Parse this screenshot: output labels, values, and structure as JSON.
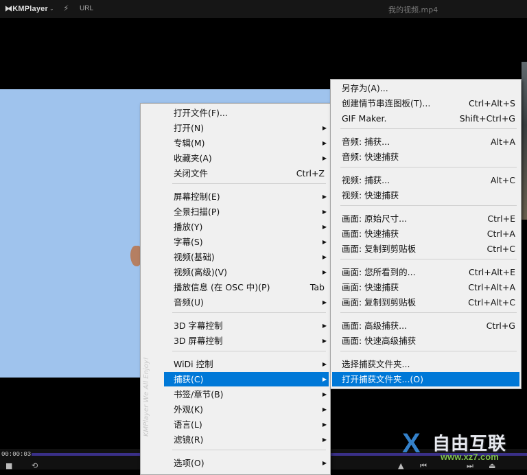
{
  "titlebar": {
    "app_name": "KMPlayer",
    "chevron": "⌄",
    "url_label": "URL",
    "file_name": "我的视频.mp4"
  },
  "player": {
    "time": "00:00:03"
  },
  "sidebar_text": "KMPlayer We All Enjoy!",
  "main_menu": [
    {
      "label": "打开文件(F)...",
      "shortcut": "",
      "submenu": false
    },
    {
      "label": "打开(N)",
      "shortcut": "",
      "submenu": true
    },
    {
      "label": "专辑(M)",
      "shortcut": "",
      "submenu": true
    },
    {
      "label": "收藏夹(A)",
      "shortcut": "",
      "submenu": true
    },
    {
      "label": "关闭文件",
      "shortcut": "Ctrl+Z",
      "submenu": false
    },
    {
      "label": "屏幕控制(E)",
      "shortcut": "",
      "submenu": true
    },
    {
      "label": "全景扫描(P)",
      "shortcut": "",
      "submenu": true
    },
    {
      "label": "播放(Y)",
      "shortcut": "",
      "submenu": true
    },
    {
      "label": "字幕(S)",
      "shortcut": "",
      "submenu": true
    },
    {
      "label": "视频(基础)",
      "shortcut": "",
      "submenu": true
    },
    {
      "label": "视频(高级)(V)",
      "shortcut": "",
      "submenu": true
    },
    {
      "label": "播放信息 (在 OSC 中)(P)",
      "shortcut": "Tab",
      "submenu": false
    },
    {
      "label": "音频(U)",
      "shortcut": "",
      "submenu": true
    },
    {
      "label": "3D 字幕控制",
      "shortcut": "",
      "submenu": true
    },
    {
      "label": "3D 屏幕控制",
      "shortcut": "",
      "submenu": true
    },
    {
      "label": "WiDi 控制",
      "shortcut": "",
      "submenu": true
    },
    {
      "label": "捕获(C)",
      "shortcut": "",
      "submenu": true,
      "highlighted": true
    },
    {
      "label": "书签/章节(B)",
      "shortcut": "",
      "submenu": true
    },
    {
      "label": "外观(K)",
      "shortcut": "",
      "submenu": true
    },
    {
      "label": "语言(L)",
      "shortcut": "",
      "submenu": true
    },
    {
      "label": "滤镜(R)",
      "shortcut": "",
      "submenu": true
    },
    {
      "label": "选项(O)",
      "shortcut": "",
      "submenu": true
    }
  ],
  "capture_menu": [
    {
      "label": "另存为(A)...",
      "shortcut": ""
    },
    {
      "label": "创建情节串连图板(T)...",
      "shortcut": "Ctrl+Alt+S"
    },
    {
      "label": "GIF Maker.",
      "shortcut": "Shift+Ctrl+G"
    },
    {
      "label": "音频: 捕获...",
      "shortcut": "Alt+A"
    },
    {
      "label": "音频: 快速捕获",
      "shortcut": ""
    },
    {
      "label": "视频: 捕获...",
      "shortcut": "Alt+C"
    },
    {
      "label": "视频: 快速捕获",
      "shortcut": ""
    },
    {
      "label": "画面: 原始尺寸...",
      "shortcut": "Ctrl+E"
    },
    {
      "label": "画面: 快速捕获",
      "shortcut": "Ctrl+A"
    },
    {
      "label": "画面: 复制到剪贴板",
      "shortcut": "Ctrl+C"
    },
    {
      "label": "画面: 您所看到的...",
      "shortcut": "Ctrl+Alt+E"
    },
    {
      "label": "画面: 快速捕获",
      "shortcut": "Ctrl+Alt+A"
    },
    {
      "label": "画面: 复制到剪贴板",
      "shortcut": "Ctrl+Alt+C"
    },
    {
      "label": "画面: 高级捕获...",
      "shortcut": "Ctrl+G"
    },
    {
      "label": "画面: 快速高级捕获",
      "shortcut": ""
    },
    {
      "label": "选择捕获文件夹...",
      "shortcut": ""
    },
    {
      "label": "打开捕获文件夹...(O)",
      "shortcut": "",
      "highlighted": true
    }
  ],
  "watermark": {
    "logo": "X",
    "title": "自由互联",
    "url": "www.xz7.com"
  },
  "colors": {
    "highlight": "#0078d7",
    "menu_bg": "#f0f0f0",
    "video_sky": "#9fc3ed",
    "seek_bar": "#3a3088"
  }
}
